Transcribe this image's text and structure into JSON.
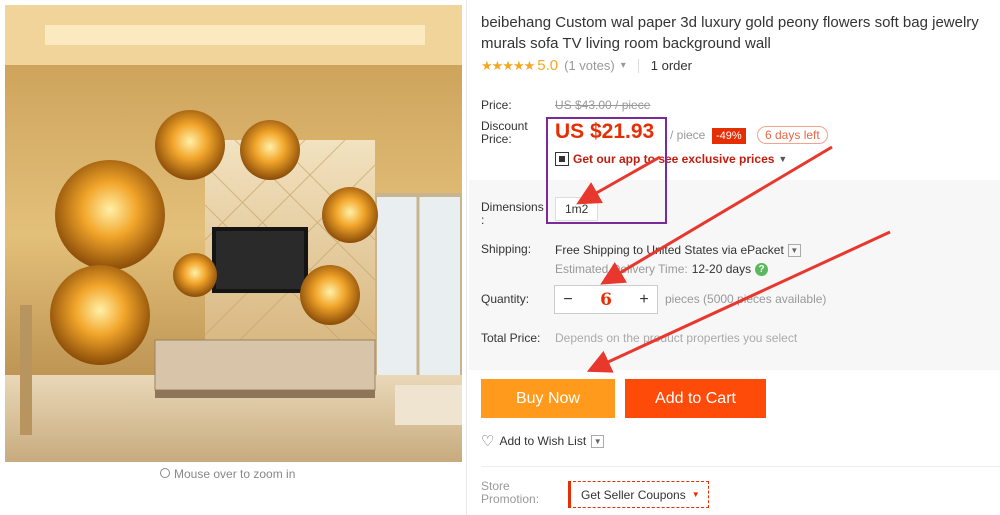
{
  "product": {
    "title": "beibehang Custom wal paper 3d luxury gold peony flowers soft bag jewelry murals sofa TV living room background wall",
    "stars": "★★★★★",
    "rating": "5.0",
    "votes": "(1 votes)",
    "orders": "1 order",
    "zoom_hint": "Mouse over to zoom in"
  },
  "pricing": {
    "price_label": "Price:",
    "original_price": "US $43.00 / piece",
    "discount_label_1": "Discount",
    "discount_label_2": "Price:",
    "discount_price": "US $21.93",
    "per_unit": "/ piece",
    "discount_badge": "-49%",
    "days_left": "6 days left",
    "app_prompt": "Get our app to see exclusive prices"
  },
  "options": {
    "dimensions_label_1": "Dimensions",
    "dimensions_label_2": ":",
    "dimension_value": "1m2",
    "shipping_label": "Shipping:",
    "shipping_text": "Free Shipping to United States via ePacket",
    "delivery_label": "Estimated Delivery Time:",
    "delivery_value": "12-20 days",
    "quantity_label": "Quantity:",
    "quantity_minus": "−",
    "quantity_value": "6",
    "quantity_plus": "+",
    "pieces_text": "pieces (5000 pieces available)",
    "total_label": "Total Price:",
    "total_text": "Depends on the product properties you select"
  },
  "actions": {
    "buy_now": "Buy Now",
    "add_to_cart": "Add to Cart",
    "wish_list": "Add to Wish List"
  },
  "store": {
    "promotion_label_1": "Store",
    "promotion_label_2": "Promotion:",
    "coupon_label": "Get Seller Coupons"
  },
  "colors": {
    "price_red": "#e62e04",
    "buy_orange": "#ff9a1d",
    "cart_red_orange": "#ff4b0a",
    "star_gold": "#f5a623",
    "annotation_red": "#e8372c",
    "highlight_purple": "#7a2a9a"
  }
}
